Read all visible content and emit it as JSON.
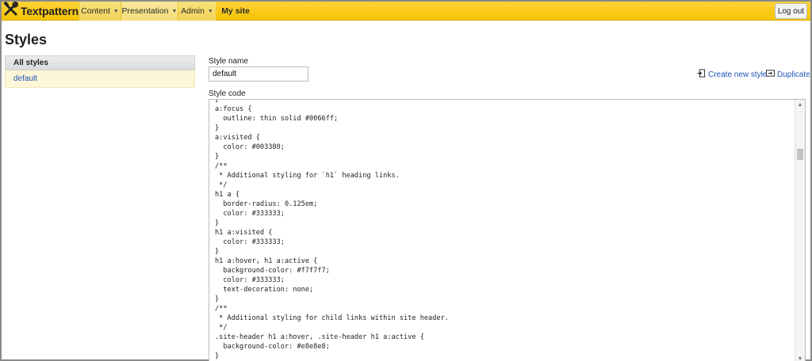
{
  "topbar": {
    "brand": "Textpattern",
    "nav": [
      {
        "label": "Content"
      },
      {
        "label": "Presentation"
      },
      {
        "label": "Admin"
      },
      {
        "label": "My site"
      }
    ],
    "logout": "Log out"
  },
  "page": {
    "title": "Styles"
  },
  "sidebar": {
    "heading": "All styles",
    "items": [
      {
        "label": "default"
      }
    ]
  },
  "form": {
    "style_name_label": "Style name",
    "style_name_value": "default",
    "style_code_label": "Style code",
    "create_new": "Create new style",
    "duplicate": "Duplicate"
  },
  "code_lines": [
    "}",
    "a:focus {",
    "  outline: thin solid #0066ff;",
    "}",
    "a:visited {",
    "  color: #003380;",
    "}",
    "/**",
    " * Additional styling for `h1` heading links.",
    " */",
    "h1 a {",
    "  border-radius: 0.125em;",
    "  color: #333333;",
    "}",
    "h1 a:visited {",
    "  color: #333333;",
    "}",
    "h1 a:hover, h1 a:active {",
    "  background-color: #f7f7f7;",
    "  color: #333333;",
    "  text-decoration: none;",
    "}",
    "/**",
    " * Additional styling for child links within site header.",
    " */",
    ".site-header h1 a:hover, .site-header h1 a:active {",
    "  background-color: #e8e8e8;",
    "}"
  ],
  "colors": {
    "topbar": "#f5c400",
    "link": "#1e55b8",
    "selected_row": "#fdf6d8"
  }
}
